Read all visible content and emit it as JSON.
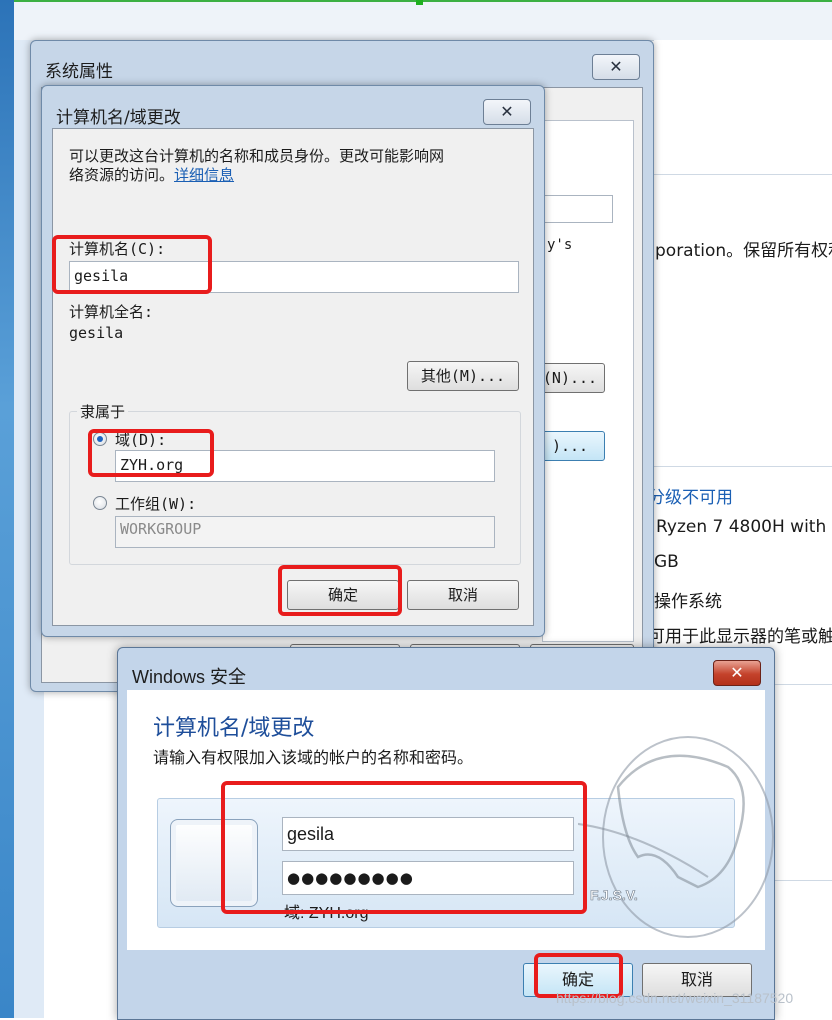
{
  "background": {
    "control_panel_lines": [
      {
        "text": "y's",
        "partial": true
      },
      {
        "text": "poration。保留所有权利"
      },
      {
        "text": "(N)..."
      },
      {
        "text": ")..."
      },
      {
        "text": "分级不可用",
        "link": true
      },
      {
        "text": "Ryzen 7 4800H with"
      },
      {
        "text": "GB"
      },
      {
        "text": "操作系统"
      },
      {
        "text": "可用于此显示器的笔或触"
      }
    ]
  },
  "system_properties": {
    "title": "系统属性",
    "close_glyph": "✕"
  },
  "name_dialog": {
    "title": "计算机名/域更改",
    "close_glyph": "✕",
    "description": "可以更改这台计算机的名称和成员身份。更改可能影响网络资源的访问。",
    "description_line1": "可以更改这台计算机的名称和成员身份。更改可能影响网",
    "description_line2_prefix": "络资源的访问。",
    "details_link": "详细信息",
    "computer_name_label": "计算机名(C):",
    "computer_name_value": "gesila",
    "full_name_label": "计算机全名:",
    "full_name_value": "gesila",
    "more_button": "其他(M)...",
    "member_of_label": "隶属于",
    "domain_label": "域(D):",
    "domain_value": "ZYH.org",
    "workgroup_label": "工作组(W):",
    "workgroup_value": "WORKGROUP",
    "selected_option": "domain",
    "ok_button": "确定",
    "cancel_button": "取消"
  },
  "security_dialog": {
    "title": "Windows 安全",
    "close_glyph": "✕",
    "heading": "计算机名/域更改",
    "subtitle": "请输入有权限加入该域的帐户的名称和密码。",
    "username_value": "gesila",
    "password_mask": "●●●●●●●●●",
    "domain_line": "域: ZYH.org",
    "ok_button": "确定",
    "cancel_button": "取消"
  },
  "watermark": {
    "text": "https://blog.csdn.net/weixin_31187520",
    "logo_text": "F.J.S.V."
  },
  "colors": {
    "highlight_box": "#e81c1c",
    "heading_blue": "#1e4e9a",
    "link_blue": "#1a5fb4"
  }
}
